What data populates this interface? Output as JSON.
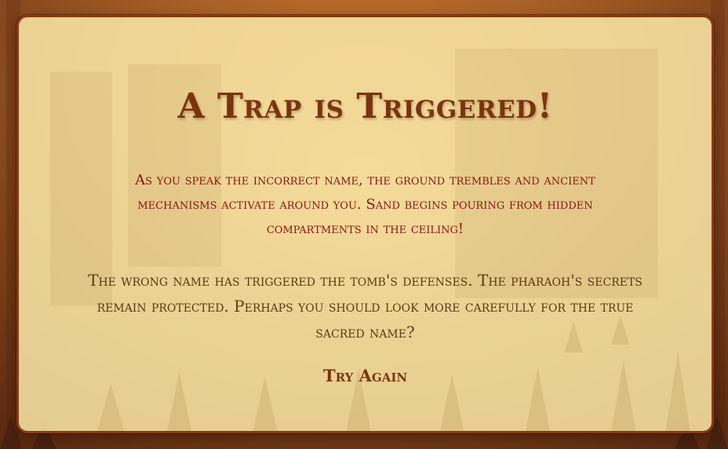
{
  "colors": {
    "panel_border": "#8b3a12",
    "panel_fill": "#fae8a8",
    "title": "#7a3410",
    "warning_text": "#8e1212",
    "body_text": "#5b3a17"
  },
  "dialog": {
    "title": "A Trap is Triggered!",
    "warning": "As you speak the incorrect name, the ground trembles and ancient mechanisms activate around you. Sand begins pouring from hidden compartments in the ceiling!",
    "message": "The wrong name has triggered the tomb's defenses. The pharaoh's secrets remain protected. Perhaps you should look more carefully for the true sacred name?",
    "retry_label": "Try Again"
  }
}
